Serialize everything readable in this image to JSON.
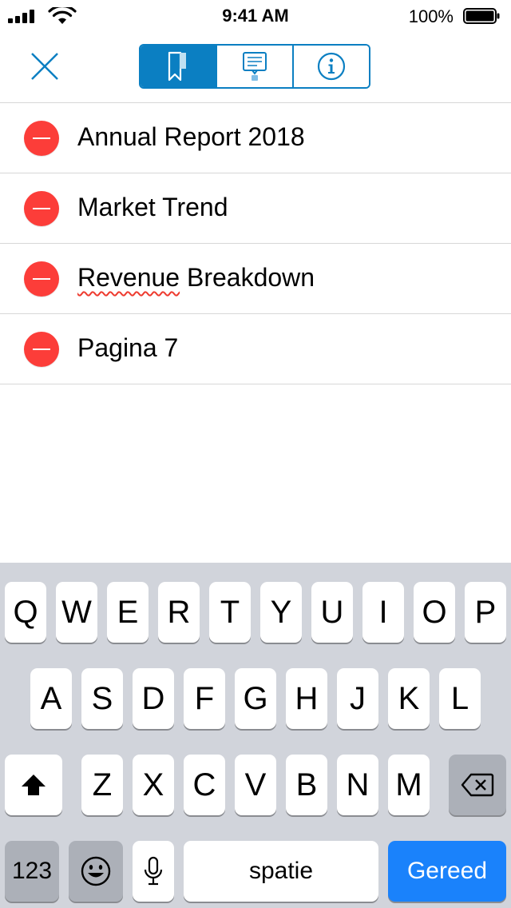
{
  "status_bar": {
    "time": "9:41 AM",
    "battery_percent": "100%",
    "icons": [
      "signal-icon",
      "wifi-icon",
      "battery-icon"
    ]
  },
  "toolbar": {
    "close_icon": "close-icon",
    "tabs": [
      {
        "name": "bookmarks",
        "icon": "bookmark-icon",
        "active": true
      },
      {
        "name": "annotations",
        "icon": "comment-icon",
        "active": false
      },
      {
        "name": "info",
        "icon": "info-icon",
        "active": false
      }
    ],
    "accent_color": "#0b7fc2"
  },
  "bookmarks": {
    "items": [
      {
        "title": "Annual Report 2018"
      },
      {
        "title": "Market Trend"
      },
      {
        "title_underlined": "Revenue",
        "title_rest": " Breakdown"
      },
      {
        "title": "Pagina 7"
      }
    ],
    "delete_color": "#fc3d39"
  },
  "keyboard": {
    "row1": [
      "Q",
      "W",
      "E",
      "R",
      "T",
      "Y",
      "U",
      "I",
      "O",
      "P"
    ],
    "row2": [
      "A",
      "S",
      "D",
      "F",
      "G",
      "H",
      "J",
      "K",
      "L"
    ],
    "row3": [
      "Z",
      "X",
      "C",
      "V",
      "B",
      "N",
      "M"
    ],
    "numbers_label": "123",
    "space_label": "spatie",
    "done_label": "Gereed",
    "done_color": "#1a82fb"
  }
}
